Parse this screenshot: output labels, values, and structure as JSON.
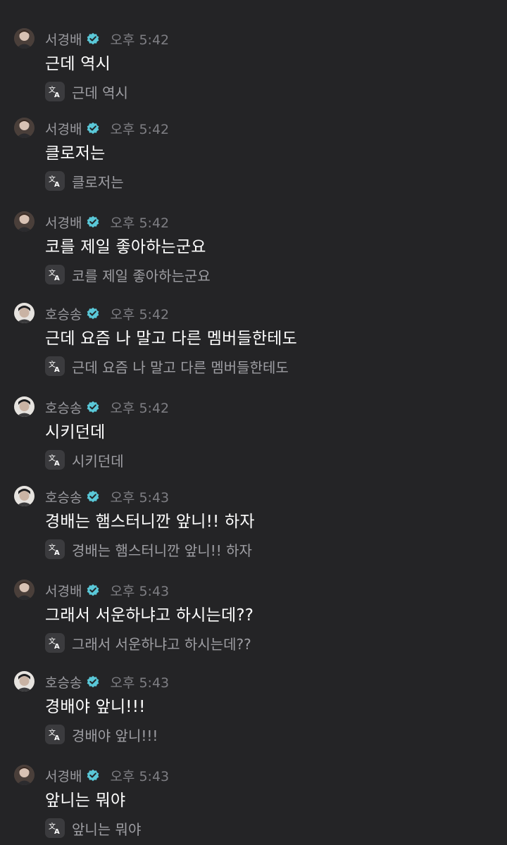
{
  "colors": {
    "background": "#242426",
    "verified_badge": "#5ac8d8",
    "name": "#9a9a9f",
    "time": "#7e7e83",
    "message": "#ffffff",
    "translated": "#9e9ea3"
  },
  "icons": {
    "verified": "verified-badge-icon",
    "translate": "translate-icon"
  },
  "messages": [
    {
      "name": "서경배",
      "time": "오후 5:42",
      "text": "근데 역시",
      "translation": "근데 역시"
    },
    {
      "name": "서경배",
      "time": "오후 5:42",
      "text": "클로저는",
      "translation": "클로저는"
    },
    {
      "name": "서경배",
      "time": "오후 5:42",
      "text": "코를 제일 좋아하는군요",
      "translation": "코를 제일 좋아하는군요"
    },
    {
      "name": "호승송",
      "time": "오후 5:42",
      "text": "근데 요즘 나 말고 다른 멤버들한테도",
      "translation": "근데 요즘 나 말고 다른 멤버들한테도"
    },
    {
      "name": "호승송",
      "time": "오후 5:42",
      "text": "시키던데",
      "translation": "시키던데"
    },
    {
      "name": "호승송",
      "time": "오후 5:43",
      "text": "경배는 햄스터니깐 앞니!! 하자",
      "translation": "경배는 햄스터니깐 앞니!! 하자"
    },
    {
      "name": "서경배",
      "time": "오후 5:43",
      "text": "그래서 서운하냐고 하시는데??",
      "translation": "그래서 서운하냐고 하시는데??"
    },
    {
      "name": "호승송",
      "time": "오후 5:43",
      "text": "경배야 앞니!!!",
      "translation": "경배야 앞니!!!"
    },
    {
      "name": "서경배",
      "time": "오후 5:43",
      "text": "앞니는 뭐야",
      "translation": "앞니는 뭐야"
    }
  ]
}
